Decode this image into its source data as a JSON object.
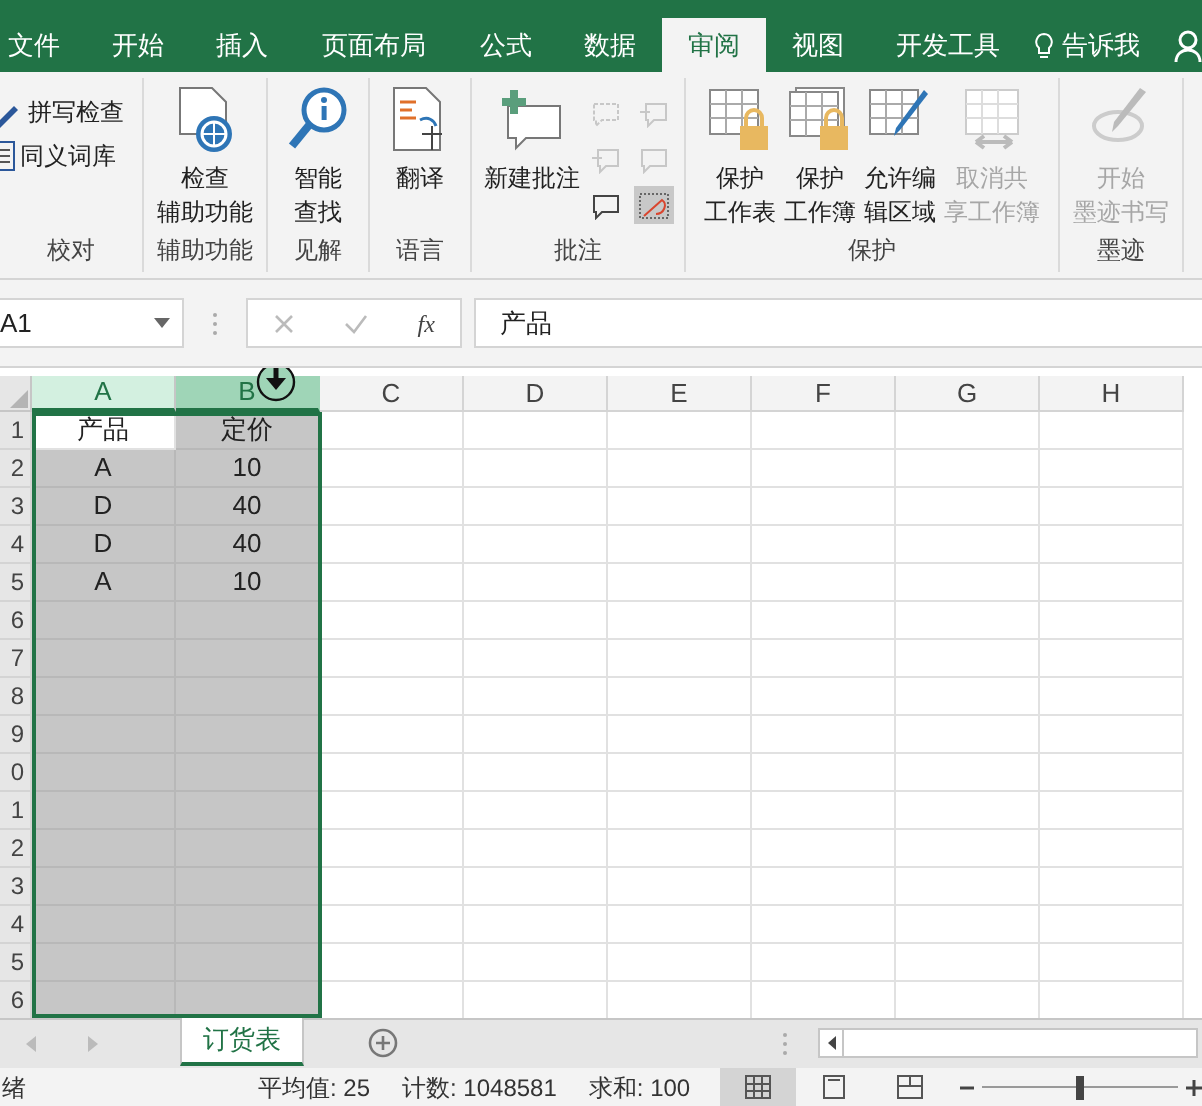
{
  "tabs": [
    {
      "label": "文件",
      "selected": false
    },
    {
      "label": "开始",
      "selected": false
    },
    {
      "label": "插入",
      "selected": false
    },
    {
      "label": "页面布局",
      "selected": false
    },
    {
      "label": "公式",
      "selected": false
    },
    {
      "label": "数据",
      "selected": false
    },
    {
      "label": "审阅",
      "selected": true
    },
    {
      "label": "视图",
      "selected": false
    },
    {
      "label": "开发工具",
      "selected": false
    }
  ],
  "tell_me": "告诉我",
  "ribbon_groups": [
    {
      "label": "校对",
      "items": [
        {
          "kind": "small",
          "lines": [
            "拼写检查"
          ],
          "disabled": false
        },
        {
          "kind": "small",
          "lines": [
            "同义词库"
          ],
          "disabled": false
        }
      ]
    },
    {
      "label": "辅助功能",
      "items": [
        {
          "kind": "large",
          "lines": [
            "检查",
            "辅助功能"
          ],
          "disabled": false
        }
      ]
    },
    {
      "label": "见解",
      "items": [
        {
          "kind": "large",
          "lines": [
            "智能",
            "查找"
          ],
          "disabled": false
        }
      ]
    },
    {
      "label": "语言",
      "items": [
        {
          "kind": "large",
          "lines": [
            "翻译"
          ],
          "disabled": false
        }
      ]
    },
    {
      "label": "批注",
      "items": [
        {
          "kind": "large",
          "lines": [
            "新建批注"
          ],
          "disabled": false
        },
        {
          "kind": "icons",
          "icons": [
            {
              "disabled": true,
              "selected": false
            },
            {
              "disabled": true,
              "selected": false
            },
            {
              "disabled": true,
              "selected": false
            },
            {
              "disabled": true,
              "selected": false
            },
            {
              "disabled": false,
              "selected": false
            },
            {
              "disabled": false,
              "selected": true
            }
          ]
        }
      ]
    },
    {
      "label": "保护",
      "items": [
        {
          "kind": "large",
          "lines": [
            "保护",
            "工作表"
          ],
          "disabled": false
        },
        {
          "kind": "large",
          "lines": [
            "保护",
            "工作簿"
          ],
          "disabled": false
        },
        {
          "kind": "large",
          "lines": [
            "允许编",
            "辑区域"
          ],
          "disabled": false
        },
        {
          "kind": "large",
          "lines": [
            "取消共",
            "享工作簿"
          ],
          "disabled": true
        }
      ]
    },
    {
      "label": "墨迹",
      "items": [
        {
          "kind": "large",
          "lines": [
            "开始",
            "墨迹书写"
          ],
          "disabled": true
        }
      ]
    }
  ],
  "formula_bar": {
    "name_box": "A1",
    "fx": "fx",
    "formula": "产品"
  },
  "columns": [
    {
      "label": "A",
      "selected": true,
      "hovered": false
    },
    {
      "label": "B",
      "selected": true,
      "hovered": true
    },
    {
      "label": "C",
      "selected": false,
      "hovered": false
    },
    {
      "label": "D",
      "selected": false,
      "hovered": false
    },
    {
      "label": "E",
      "selected": false,
      "hovered": false
    },
    {
      "label": "F",
      "selected": false,
      "hovered": false
    },
    {
      "label": "G",
      "selected": false,
      "hovered": false
    },
    {
      "label": "H",
      "selected": false,
      "hovered": false
    }
  ],
  "rows": [
    {
      "header": "1",
      "cells": [
        {
          "text": "产品",
          "selected": false
        },
        {
          "text": "定价",
          "selected": true
        }
      ]
    },
    {
      "header": "2",
      "cells": [
        {
          "text": "A",
          "selected": true
        },
        {
          "text": "10",
          "selected": true
        }
      ]
    },
    {
      "header": "3",
      "cells": [
        {
          "text": "D",
          "selected": true
        },
        {
          "text": "40",
          "selected": true
        }
      ]
    },
    {
      "header": "4",
      "cells": [
        {
          "text": "D",
          "selected": true
        },
        {
          "text": "40",
          "selected": true
        }
      ]
    },
    {
      "header": "5",
      "cells": [
        {
          "text": "A",
          "selected": true
        },
        {
          "text": "10",
          "selected": true
        }
      ]
    },
    {
      "header": "6",
      "cells": [
        {
          "selected": true
        },
        {
          "selected": true
        }
      ]
    },
    {
      "header": "7",
      "cells": [
        {
          "selected": true
        },
        {
          "selected": true
        }
      ]
    },
    {
      "header": "8",
      "cells": [
        {
          "selected": true
        },
        {
          "selected": true
        }
      ]
    },
    {
      "header": "9",
      "cells": [
        {
          "selected": true
        },
        {
          "selected": true
        }
      ]
    },
    {
      "header": "0",
      "cells": [
        {
          "selected": true
        },
        {
          "selected": true
        }
      ]
    },
    {
      "header": "1",
      "cells": [
        {
          "selected": true
        },
        {
          "selected": true
        }
      ]
    },
    {
      "header": "2",
      "cells": [
        {
          "selected": true
        },
        {
          "selected": true
        }
      ]
    },
    {
      "header": "3",
      "cells": [
        {
          "selected": true
        },
        {
          "selected": true
        }
      ]
    },
    {
      "header": "4",
      "cells": [
        {
          "selected": true
        },
        {
          "selected": true
        }
      ]
    },
    {
      "header": "5",
      "cells": [
        {
          "selected": true
        },
        {
          "selected": true
        }
      ]
    },
    {
      "header": "6",
      "cells": [
        {
          "selected": true
        },
        {
          "selected": true
        }
      ]
    }
  ],
  "sheet_tabs": [
    {
      "label": "订货表",
      "selected": true
    }
  ],
  "status_bar": {
    "ready": "绪",
    "stats": [
      "平均值: 25",
      "计数: 1048581",
      "求和: 100"
    ],
    "views": [
      {
        "kind": "normal",
        "selected": true
      },
      {
        "kind": "page_layout",
        "selected": false
      },
      {
        "kind": "page_break",
        "selected": false
      }
    ],
    "zoom": {
      "level": 0.5
    }
  }
}
